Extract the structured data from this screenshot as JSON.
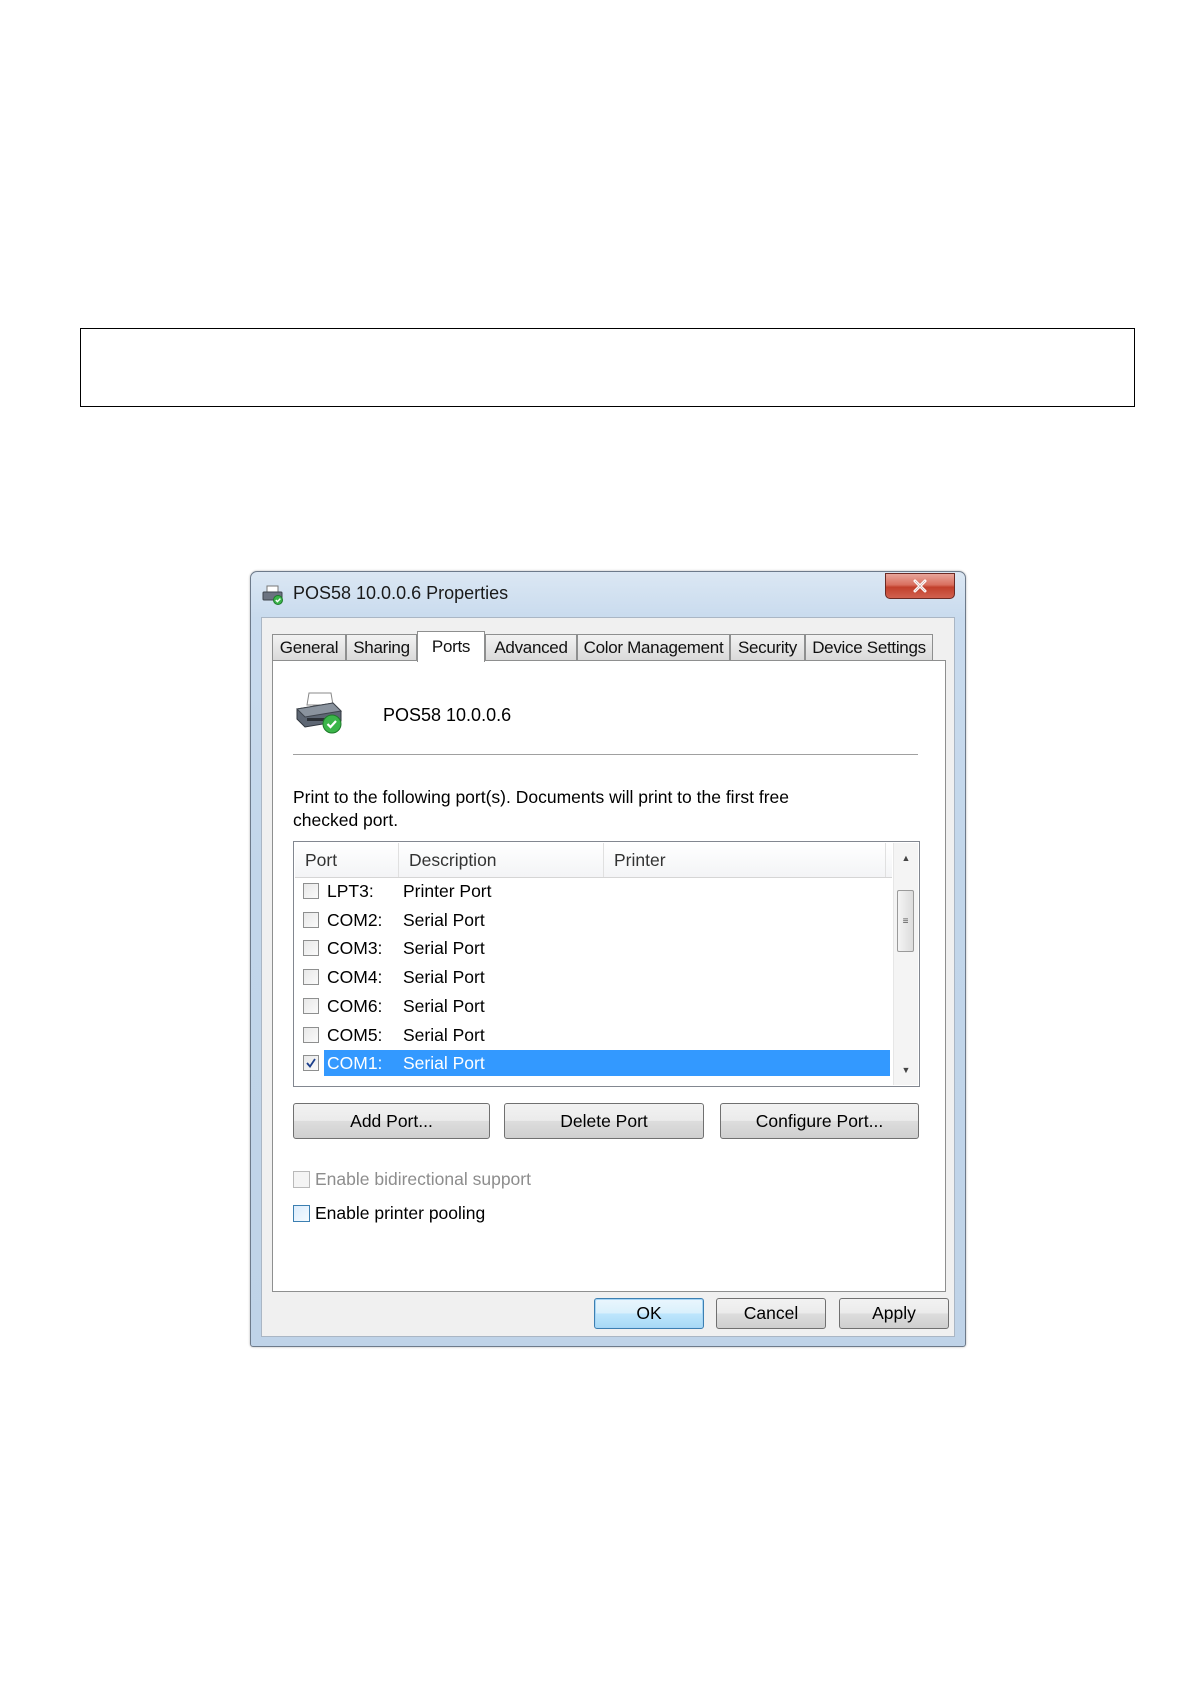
{
  "dialog": {
    "title": "POS58 10.0.0.6 Properties",
    "tabs": [
      {
        "label": "General"
      },
      {
        "label": "Sharing"
      },
      {
        "label": "Ports"
      },
      {
        "label": "Advanced"
      },
      {
        "label": "Color Management"
      },
      {
        "label": "Security"
      },
      {
        "label": "Device Settings"
      }
    ],
    "active_tab": "Ports",
    "printer_name": "POS58 10.0.0.6",
    "description": "Print to the following port(s). Documents will print to the first free checked port.",
    "ports_table": {
      "columns": [
        "Port",
        "Description",
        "Printer"
      ],
      "rows": [
        {
          "port": "LPT3:",
          "description": "Printer Port",
          "checked": false,
          "selected": false
        },
        {
          "port": "COM2:",
          "description": "Serial Port",
          "checked": false,
          "selected": false
        },
        {
          "port": "COM3:",
          "description": "Serial Port",
          "checked": false,
          "selected": false
        },
        {
          "port": "COM4:",
          "description": "Serial Port",
          "checked": false,
          "selected": false
        },
        {
          "port": "COM6:",
          "description": "Serial Port",
          "checked": false,
          "selected": false
        },
        {
          "port": "COM5:",
          "description": "Serial Port",
          "checked": false,
          "selected": false
        },
        {
          "port": "COM1:",
          "description": "Serial Port",
          "checked": true,
          "selected": true
        }
      ]
    },
    "buttons": {
      "add_port": "Add Port...",
      "delete_port": "Delete Port",
      "configure_port": "Configure Port...",
      "ok": "OK",
      "cancel": "Cancel",
      "apply": "Apply"
    },
    "options": {
      "bidirectional": {
        "label": "Enable bidirectional support",
        "checked": false,
        "enabled": false
      },
      "pooling": {
        "label": "Enable printer pooling",
        "checked": false,
        "enabled": true
      }
    },
    "colors": {
      "selection": "#3399ff",
      "close_button": "#c2402c"
    }
  }
}
